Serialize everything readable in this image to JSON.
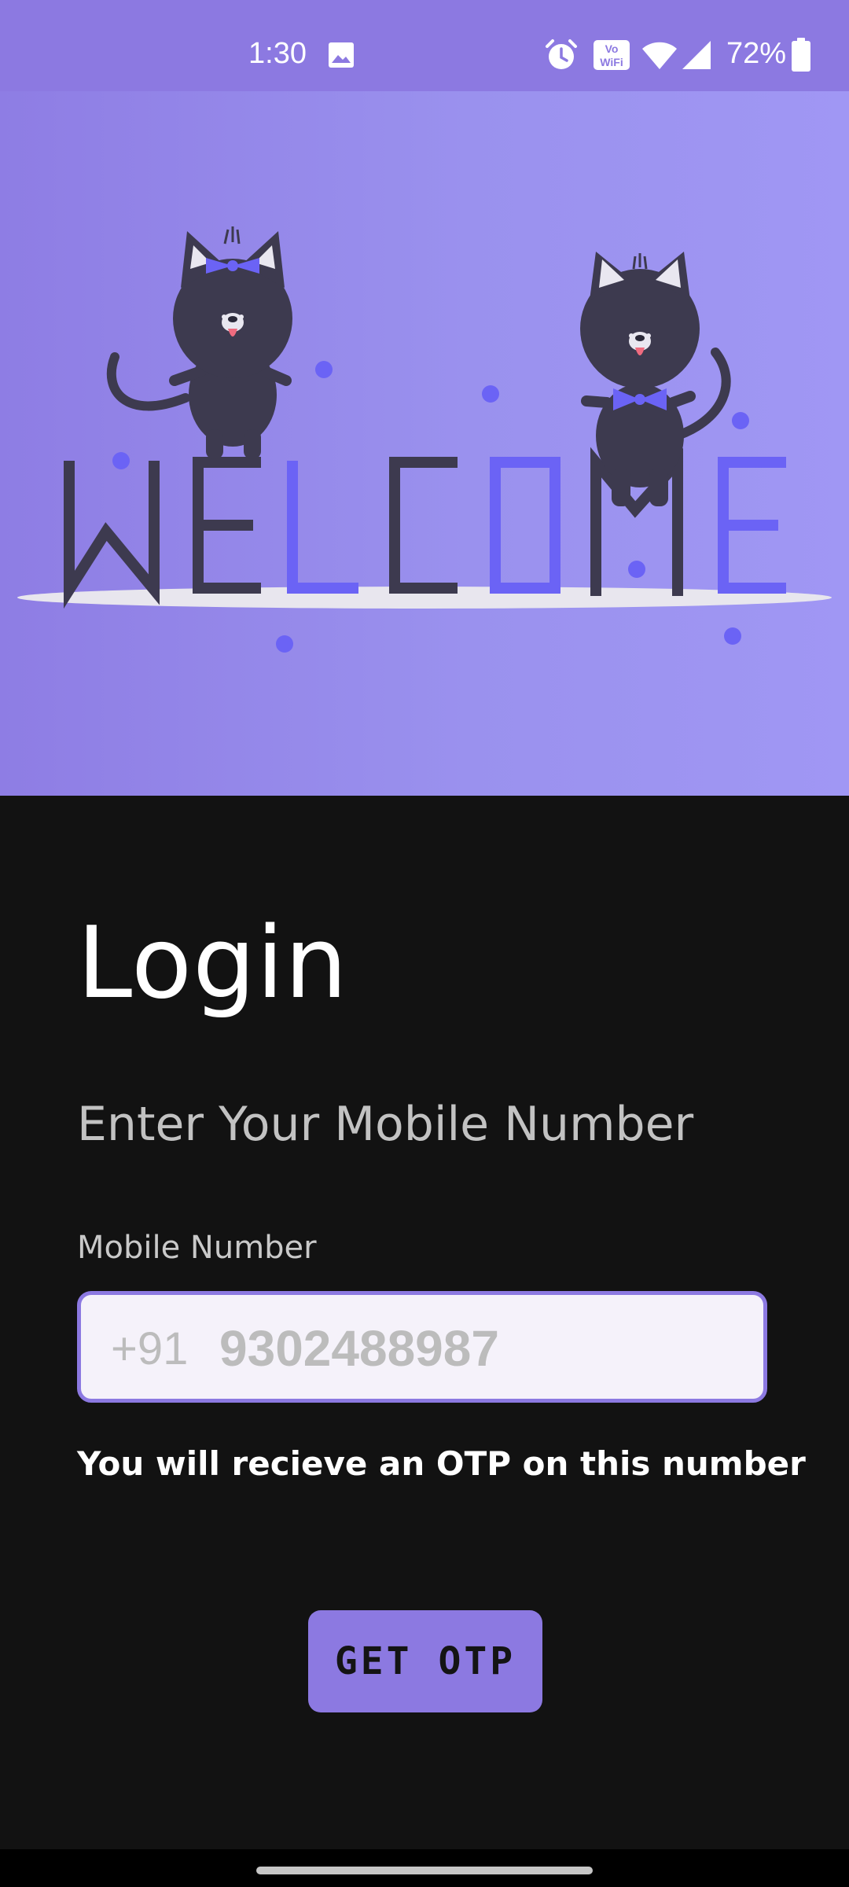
{
  "status_bar": {
    "time": "1:30",
    "battery_percent": "72%",
    "icons": [
      "image-icon",
      "alarm-icon",
      "vowifi-icon",
      "wifi-icon",
      "signal-icon",
      "battery-icon"
    ],
    "background": "#8c79e1"
  },
  "hero": {
    "word": "WELCOME",
    "letter_colors": [
      "#3d3a4f",
      "#3d3a4f",
      "#6b63f5",
      "#3d3a4f",
      "#6b63f5",
      "#3d3a4f",
      "#6b63f5"
    ],
    "accent": "#6b63f5"
  },
  "login": {
    "title": "Login",
    "subtitle": "Enter Your Mobile Number",
    "field_label": "Mobile Number",
    "country_code": "+91",
    "phone_placeholder": "9302488987",
    "helper_text": "You will recieve an OTP on this number",
    "button_label": "GET OTP",
    "accent": "#8c79e1"
  }
}
